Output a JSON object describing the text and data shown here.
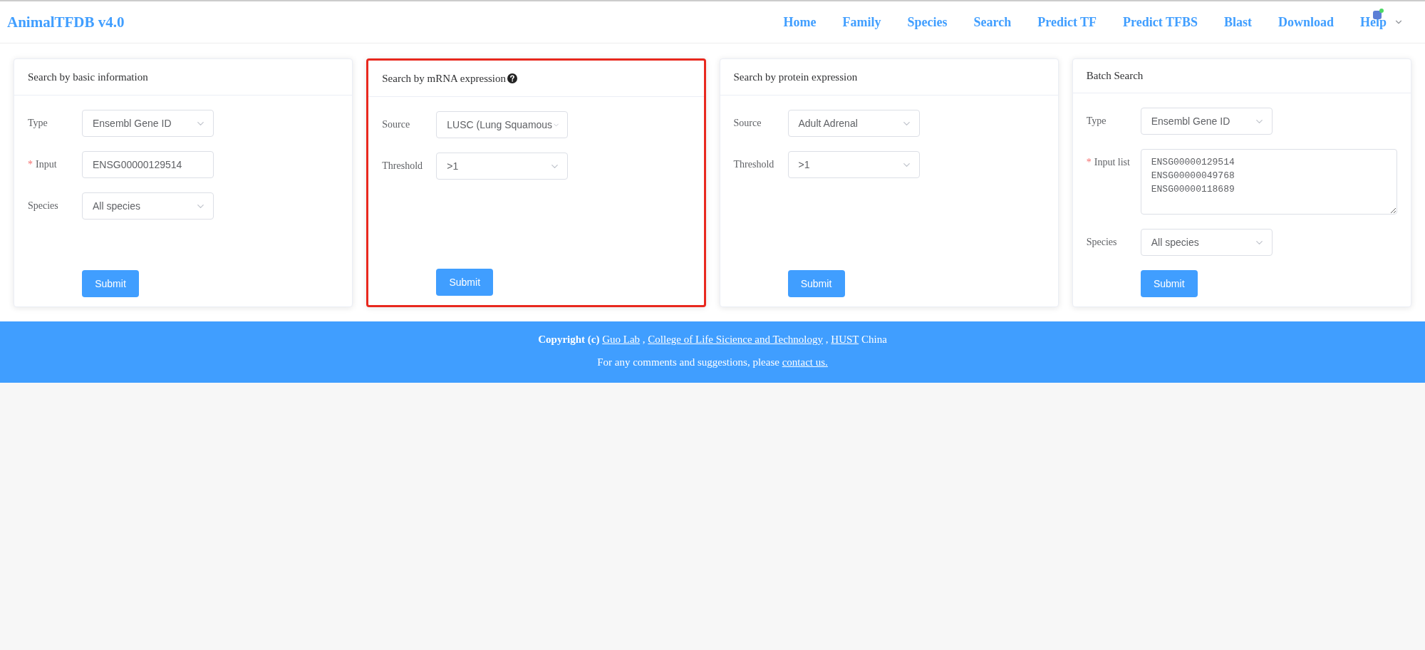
{
  "header": {
    "logo": "AnimalTFDB v4.0",
    "nav": [
      {
        "label": "Home"
      },
      {
        "label": "Family"
      },
      {
        "label": "Species"
      },
      {
        "label": "Search"
      },
      {
        "label": "Predict TF"
      },
      {
        "label": "Predict TFBS"
      },
      {
        "label": "Blast"
      },
      {
        "label": "Download"
      },
      {
        "label": "Help",
        "kind": "dropdown"
      }
    ]
  },
  "cards": [
    {
      "title": "Search by basic information",
      "highlighted": false,
      "fields": [
        {
          "kind": "select",
          "label": "Type",
          "value": "Ensembl Gene ID"
        },
        {
          "kind": "input",
          "label": "Input",
          "required_mark": "*",
          "value": "ENSG00000129514"
        },
        {
          "kind": "select",
          "label": "Species",
          "value": "All species"
        }
      ],
      "submit": "Submit"
    },
    {
      "title": "Search by mRNA expression",
      "help_icon": true,
      "highlighted": true,
      "fields": [
        {
          "kind": "select",
          "label": "Source",
          "value": "LUSC (Lung Squamous"
        },
        {
          "kind": "select",
          "label": "Threshold",
          "value": ">1"
        }
      ],
      "submit": "Submit"
    },
    {
      "title": "Search by protein expression",
      "highlighted": false,
      "fields": [
        {
          "kind": "select",
          "label": "Source",
          "value": "Adult Adrenal"
        },
        {
          "kind": "select",
          "label": "Threshold",
          "value": ">1"
        }
      ],
      "submit": "Submit"
    },
    {
      "title": "Batch Search",
      "highlighted": false,
      "fields": [
        {
          "kind": "select",
          "label": "Type",
          "value": "Ensembl Gene ID"
        },
        {
          "kind": "textarea",
          "label": "Input list",
          "required_mark": "*",
          "lines": [
            "ENSG00000129514",
            "ENSG00000049768",
            "ENSG00000118689"
          ]
        },
        {
          "kind": "select",
          "label": "Species",
          "value": "All species"
        }
      ],
      "submit": "Submit"
    }
  ],
  "footer": {
    "lines": [
      [
        {
          "kind": "bold",
          "text": "Copyright (c)"
        },
        {
          "kind": "link",
          "text": "Guo Lab"
        },
        {
          "kind": "plain",
          "text": ","
        },
        {
          "kind": "link",
          "text": "College of Life Sicience and Technology"
        },
        {
          "kind": "plain",
          "text": ","
        },
        {
          "kind": "link",
          "text": "HUST"
        },
        {
          "kind": "plain",
          "text": "China"
        }
      ],
      [
        {
          "kind": "plain",
          "text": "For any comments and suggestions, please"
        },
        {
          "kind": "link",
          "text": "contact us."
        }
      ]
    ]
  }
}
